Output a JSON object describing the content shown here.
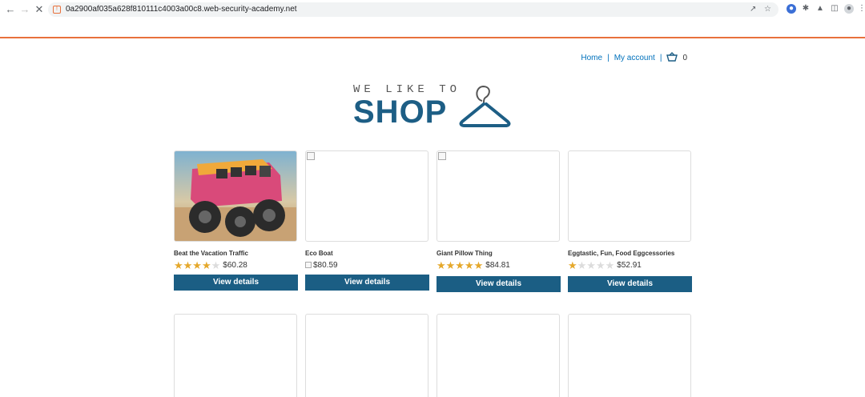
{
  "browser": {
    "url": "0a2900af035a628f810111c4003a00c8.web-security-academy.net",
    "back_icon": "arrow-left-icon",
    "forward_icon": "arrow-right-icon",
    "stop_icon": "close-icon"
  },
  "nav": {
    "home": "Home",
    "separator": "|",
    "account": "My account",
    "cart_count": "0"
  },
  "logo": {
    "top_text": "WE LIKE TO",
    "main_text": "SHOP",
    "brand_color": "#1d5e85"
  },
  "products": [
    {
      "name": "Beat the Vacation Traffic",
      "rating": 4,
      "price": "$60.28",
      "button": "View details",
      "image": "pink monster truck van"
    },
    {
      "name": "Eco Boat",
      "rating": null,
      "price": "$80.59",
      "button": "View details",
      "image": "broken"
    },
    {
      "name": "Giant Pillow Thing",
      "rating": 5,
      "price": "$84.81",
      "button": "View details",
      "image": "broken"
    },
    {
      "name": "Eggtastic, Fun, Food Eggcessories",
      "rating": 1,
      "price": "$52.91",
      "button": "View details",
      "image": "blank"
    }
  ],
  "colors": {
    "accent": "#e8713c",
    "link": "#0071bc",
    "button": "#1b5e84",
    "star": "#e5a82b"
  }
}
